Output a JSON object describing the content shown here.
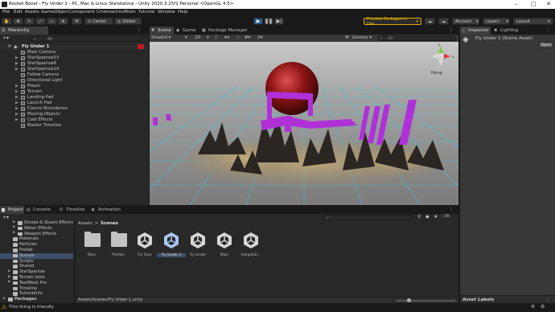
{
  "window": {
    "title": "Rocket Boost - Fly Under 1 - PC, Mac & Linux Standalone - Unity 2020.3.25f1 Personal <OpenGL 4.5>"
  },
  "menu": [
    "File",
    "Edit",
    "Assets",
    "GameObject",
    "Component",
    "Cinemachine",
    "Tools",
    "Tutorial",
    "Window",
    "Help"
  ],
  "toolbar": {
    "center_label": "Center",
    "global_label": "Global",
    "preview_packages": "Preview Packages in Use",
    "account": "Account",
    "layers": "Layers",
    "layout": "Layout"
  },
  "hierarchy": {
    "tab": "Hierarchy",
    "search_placeholder": "All",
    "scene_name": "Fly Under 1",
    "items": [
      {
        "label": "Main Camera",
        "arrow": ""
      },
      {
        "label": "StarSparrow33",
        "arrow": "▶"
      },
      {
        "label": "StarSparrow8",
        "arrow": "▶"
      },
      {
        "label": "StarSparrow14",
        "arrow": "▶"
      },
      {
        "label": "Follow Camera",
        "arrow": ""
      },
      {
        "label": "Directional Light",
        "arrow": ""
      },
      {
        "label": "Player",
        "arrow": "▶"
      },
      {
        "label": "Terrain",
        "arrow": "▶"
      },
      {
        "label": "Landing Pad",
        "arrow": "▶"
      },
      {
        "label": "Launch Pad",
        "arrow": "▶"
      },
      {
        "label": "Course Boundaries",
        "arrow": "▶"
      },
      {
        "label": "Moving Objects",
        "arrow": "▶"
      },
      {
        "label": "Cool Effects",
        "arrow": "▶"
      },
      {
        "label": "Master Timeline",
        "arrow": ""
      }
    ]
  },
  "scene": {
    "tabs": [
      "Scene",
      "Game",
      "Package Manager"
    ],
    "shading": "Shaded",
    "mode_2d": "2D",
    "gizmos": "Gizmos",
    "search_placeholder": "All",
    "persp": "Persp",
    "axis_y": "y",
    "axis_x": "x"
  },
  "inspector": {
    "tabs": [
      "Inspector",
      "Lighting"
    ],
    "asset_title": "Fly Under 1 (Scene Asset)",
    "open_button": "Open",
    "asset_labels": "Asset Labels"
  },
  "project": {
    "tabs": [
      "Project",
      "Console",
      "Timeline",
      "Animation"
    ],
    "breadcrumb_root": "Assets",
    "breadcrumb_current": "Scenes",
    "hidden_count": "16",
    "tree": [
      {
        "label": "Smoke & Steam Effects",
        "indent": 2,
        "arrow": "▶"
      },
      {
        "label": "Water Effects",
        "indent": 2,
        "arrow": "▶"
      },
      {
        "label": "Weapon Effects",
        "indent": 2,
        "arrow": "▶"
      },
      {
        "label": "Materials",
        "indent": 1,
        "arrow": ""
      },
      {
        "label": "Particles",
        "indent": 1,
        "arrow": ""
      },
      {
        "label": "Prefab",
        "indent": 1,
        "arrow": ""
      },
      {
        "label": "Scenes",
        "indent": 1,
        "arrow": "",
        "selected": true
      },
      {
        "label": "Scripts",
        "indent": 1,
        "arrow": ""
      },
      {
        "label": "Shared",
        "indent": 1,
        "arrow": ""
      },
      {
        "label": "StarSparrow",
        "indent": 1,
        "arrow": "▶"
      },
      {
        "label": "Terrain tools",
        "indent": 1,
        "arrow": "▶"
      },
      {
        "label": "TextMesh Pro",
        "indent": 1,
        "arrow": "▶"
      },
      {
        "label": "Timeline",
        "indent": 1,
        "arrow": ""
      },
      {
        "label": "TutorialInfo",
        "indent": 1,
        "arrow": ""
      },
      {
        "label": "Packages",
        "indent": 0,
        "arrow": "▶"
      }
    ],
    "assets": [
      {
        "label": "Main",
        "kind": "folder"
      },
      {
        "label": "Profiles",
        "kind": "folder"
      },
      {
        "label": "Fly Over",
        "kind": "scene"
      },
      {
        "label": "Fly Under 1",
        "kind": "scene",
        "selected": true
      },
      {
        "label": "Fly Under",
        "kind": "scene"
      },
      {
        "label": "Main",
        "kind": "scene"
      },
      {
        "label": "SampleSc...",
        "kind": "scene"
      }
    ],
    "footer_path": "Assets/Scenes/Fly Under 1.unity"
  },
  "status": {
    "message": "This thing is friendly"
  },
  "colors": {
    "accent_blue": "#2c5d87",
    "preview_yellow": "#f0c000",
    "scene_purple": "#b030d8",
    "grid_cyan": "#3ec7d8"
  }
}
